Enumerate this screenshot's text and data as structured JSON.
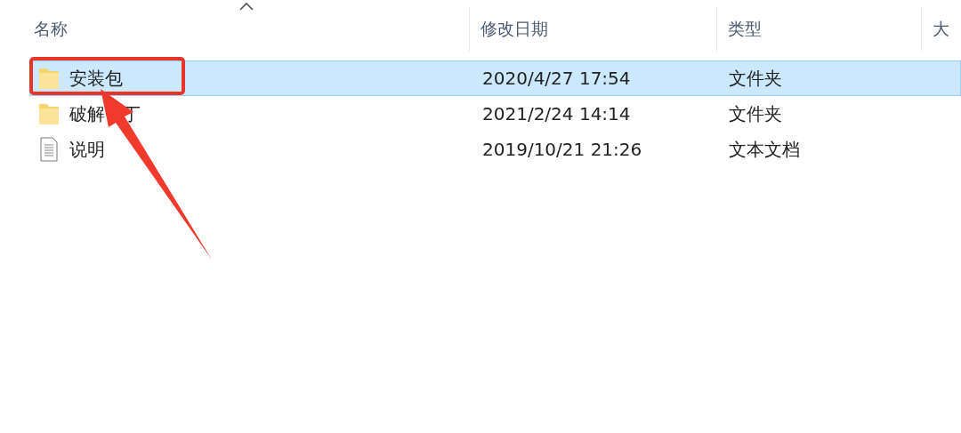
{
  "columns": [
    {
      "label": "名称",
      "sorted": true
    },
    {
      "label": "修改日期",
      "sorted": false
    },
    {
      "label": "类型",
      "sorted": false
    },
    {
      "label": "大",
      "sorted": false
    }
  ],
  "rows": [
    {
      "name_parts": [
        "安装包"
      ],
      "kind": "folder",
      "modified": "2020/4/27 17:54",
      "type": "文件夹",
      "selected": true
    },
    {
      "name_parts": [
        "破解",
        "丁"
      ],
      "kind": "folder",
      "modified": "2021/2/24 14:14",
      "type": "文件夹",
      "selected": false
    },
    {
      "name_parts": [
        "说明"
      ],
      "kind": "text",
      "modified": "2019/10/21 21:26",
      "type": "文本文档",
      "selected": false
    }
  ]
}
